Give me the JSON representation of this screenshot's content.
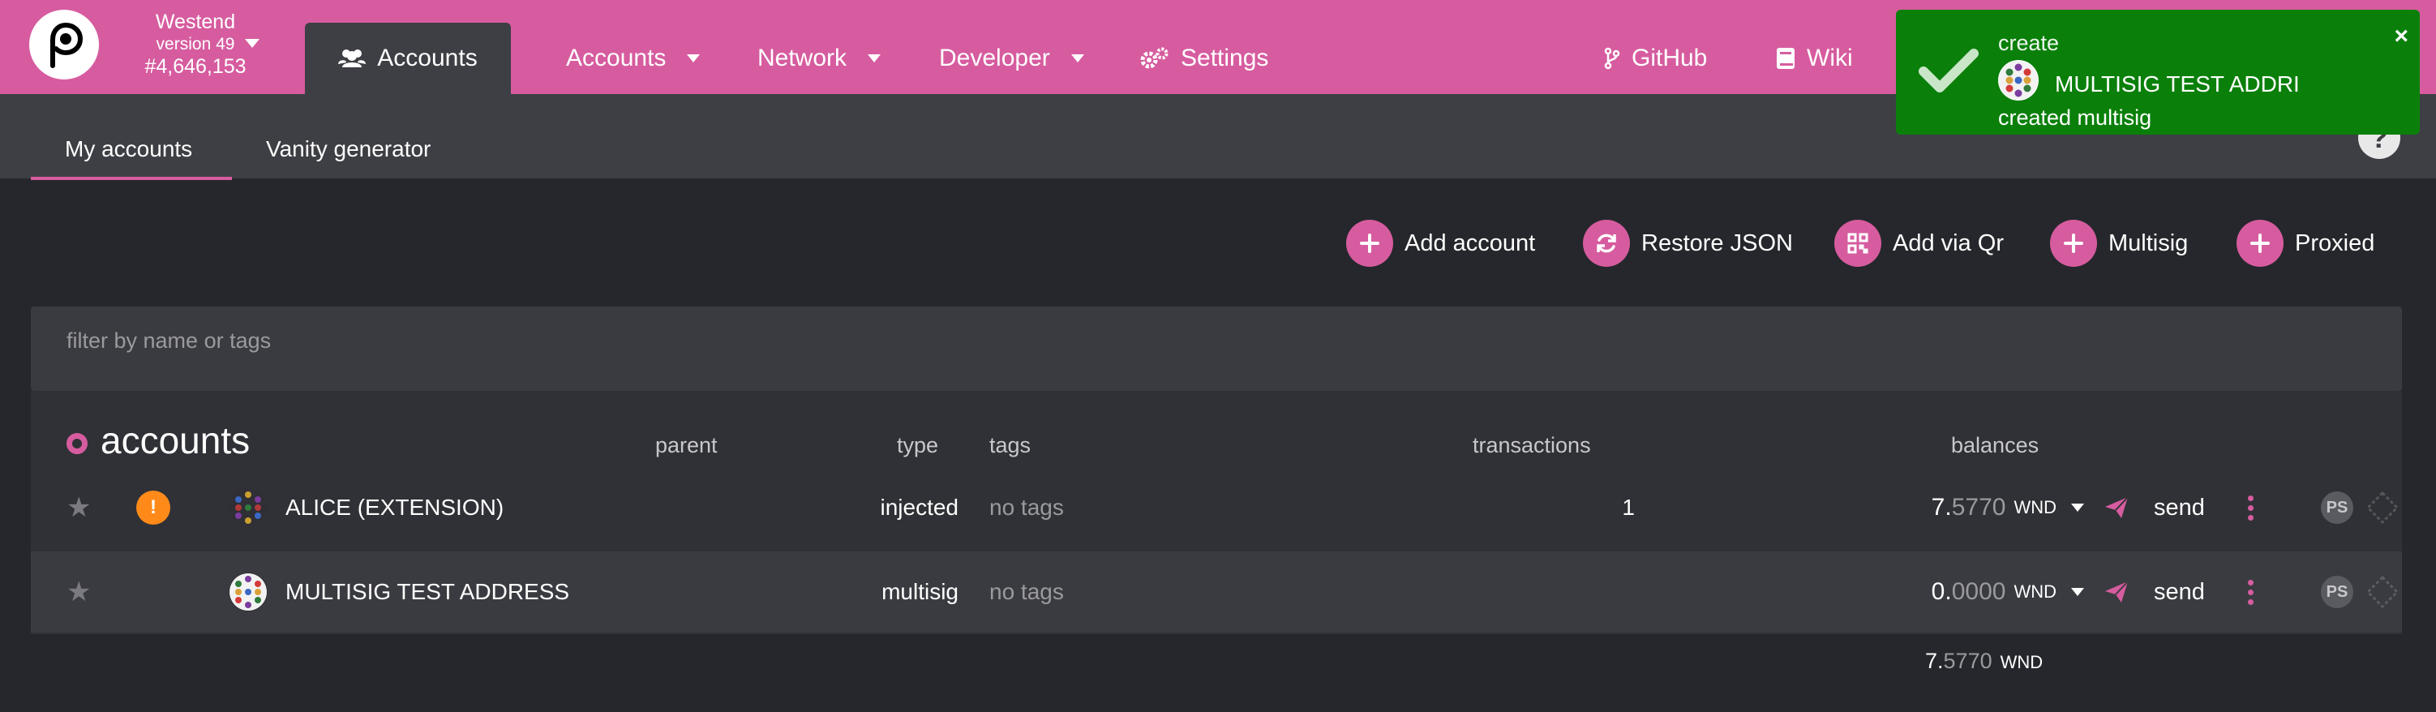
{
  "chain": {
    "name": "Westend",
    "version": "version 49",
    "block": "#4,646,153"
  },
  "nav": {
    "active_tab": "Accounts",
    "items": [
      {
        "label": "Accounts",
        "icon": "users-icon"
      },
      {
        "label": "Network"
      },
      {
        "label": "Developer"
      },
      {
        "label": "Settings",
        "icon": "gears-icon"
      },
      {
        "label": "GitHub",
        "icon": "code-branch-icon"
      },
      {
        "label": "Wiki",
        "icon": "book-icon"
      }
    ]
  },
  "toast": {
    "action": "create",
    "name": "MULTISIG TEST ADDRI",
    "message": "created multisig",
    "close": "×"
  },
  "subtabs": [
    "My accounts",
    "Vanity generator"
  ],
  "actions": [
    {
      "label": "Add account",
      "icon": "plus-icon"
    },
    {
      "label": "Restore JSON",
      "icon": "sync-icon"
    },
    {
      "label": "Add via Qr",
      "icon": "qrcode-icon"
    },
    {
      "label": "Multisig",
      "icon": "plus-icon"
    },
    {
      "label": "Proxied",
      "icon": "plus-icon"
    }
  ],
  "filter": {
    "placeholder": "filter by name or tags"
  },
  "table": {
    "title": "accounts",
    "headers": {
      "parent": "parent",
      "type": "type",
      "tags": "tags",
      "transactions": "transactions",
      "balances": "balances"
    },
    "rows": [
      {
        "name": "ALICE (EXTENSION)",
        "type": "injected",
        "tags": "no tags",
        "transactions": "1",
        "balance_int": "7.",
        "balance_dec": "5770",
        "unit": "WND",
        "send": "send",
        "ps": "PS",
        "warning": true
      },
      {
        "name": "MULTISIG TEST ADDRESS",
        "type": "multisig",
        "tags": "no tags",
        "transactions": "",
        "balance_int": "0.",
        "balance_dec": "0000",
        "unit": "WND",
        "send": "send",
        "ps": "PS",
        "warning": false
      }
    ],
    "total": {
      "int": "7.",
      "dec": "5770",
      "unit": "WND"
    }
  },
  "colors": {
    "brand": "#d65c9f",
    "toast": "#0a800a",
    "background": "#26272c"
  }
}
